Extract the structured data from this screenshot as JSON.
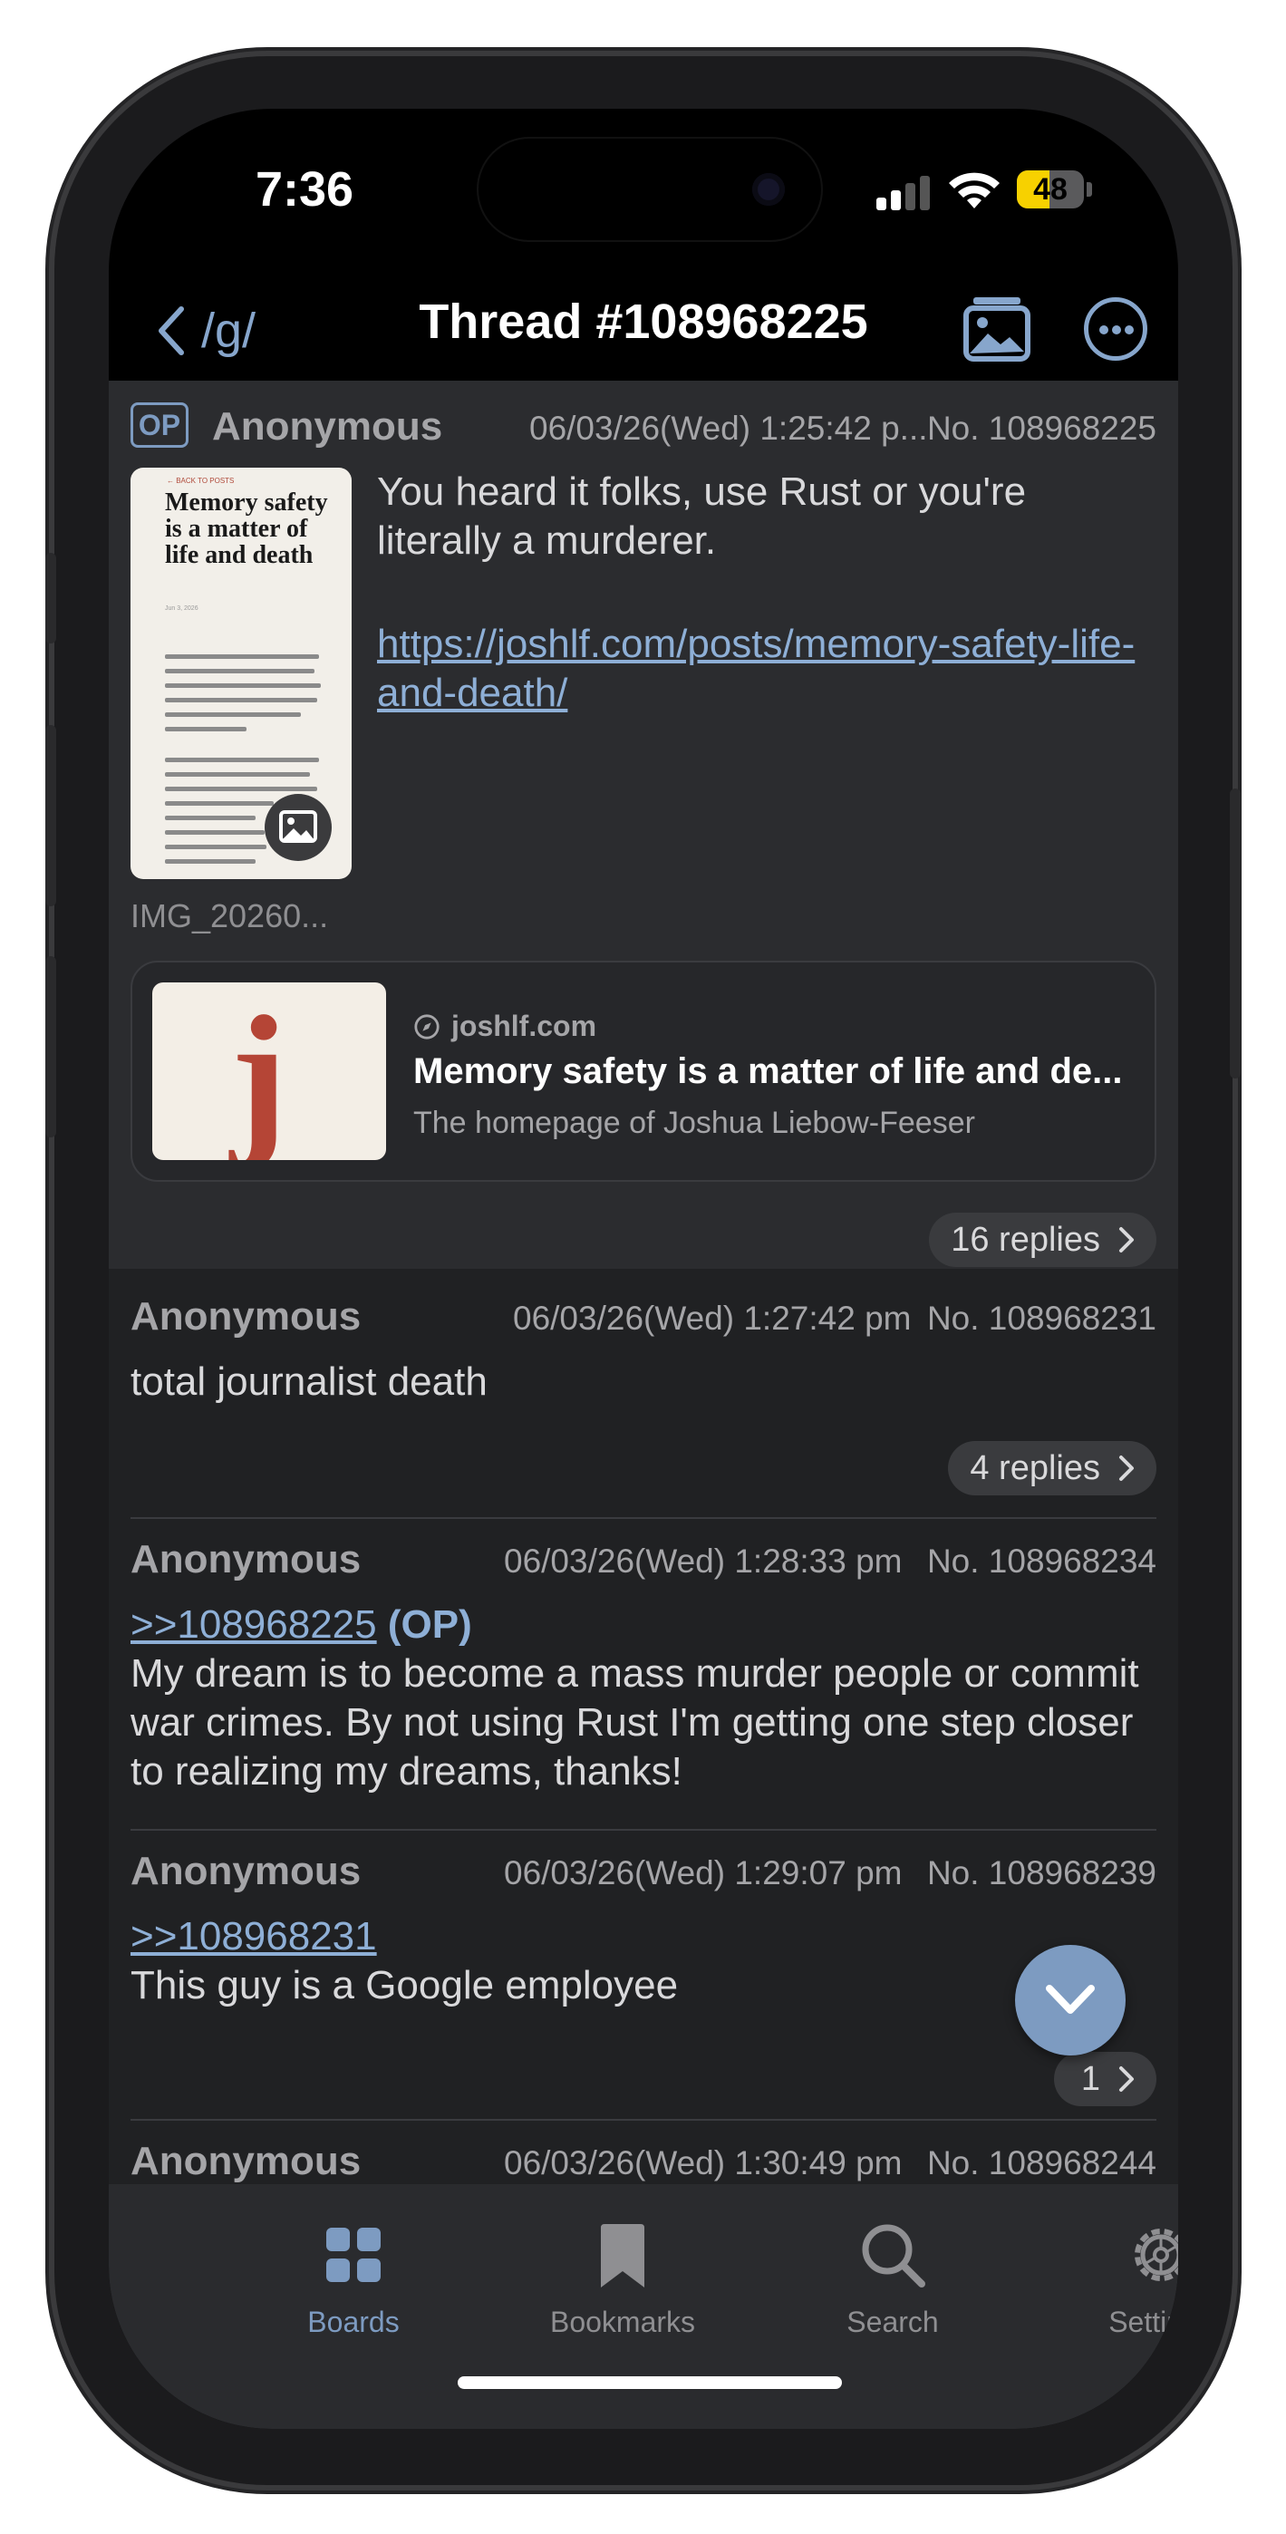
{
  "status_bar": {
    "time": "7:36",
    "battery": "48"
  },
  "nav": {
    "back_label": "/g/",
    "title": "Thread #108968225"
  },
  "op": {
    "badge": "OP",
    "name": "Anonymous",
    "date": "06/03/26(Wed) 1:25:42 p...",
    "number": "No. 108968225",
    "text": "You heard it folks, use Rust or you're literally a murderer.",
    "link": "https://joshlf.com/posts/memory-safety-life-and-death/",
    "thumbnail": {
      "filename": "IMG_20260...",
      "title": "Memory safety is a matter of life and death",
      "kicker": "← BACK TO POSTS",
      "date": "Jun 3, 2026"
    },
    "preview": {
      "domain": "joshlf.com",
      "title": "Memory safety is a matter of life and de...",
      "description": "The homepage of Joshua Liebow-Feeser",
      "image_letter": "j"
    },
    "replies": "16 replies"
  },
  "posts": [
    {
      "name": "Anonymous",
      "date": "06/03/26(Wed) 1:27:42 pm",
      "number": "No. 108968231",
      "text": "total journalist death",
      "replies": "4 replies"
    },
    {
      "name": "Anonymous",
      "date": "06/03/26(Wed) 1:28:33 pm",
      "number": "No. 108968234",
      "quote": ">>108968225",
      "quote_suffix": "(OP)",
      "text": "My dream is to become a mass murder people or commit war crimes. By not using Rust I'm getting one step closer to realizing my dreams, thanks!"
    },
    {
      "name": "Anonymous",
      "date": "06/03/26(Wed) 1:29:07 pm",
      "number": "No. 108968239",
      "quote": ">>108968231",
      "text": "This guy is a Google employee",
      "replies": "1"
    },
    {
      "name": "Anonymous",
      "date": "06/03/26(Wed) 1:30:49 pm",
      "number": "No. 108968244"
    }
  ],
  "tabs": [
    {
      "label": "Boards",
      "icon": "grid-icon",
      "active": true
    },
    {
      "label": "Bookmarks",
      "icon": "bookmark-icon",
      "active": false
    },
    {
      "label": "Search",
      "icon": "search-icon",
      "active": false
    },
    {
      "label": "Settings",
      "icon": "gear-icon",
      "active": false
    }
  ],
  "colors": {
    "accent": "#7d9bc1",
    "link": "#8eafd6",
    "background": "#202123",
    "op_background": "#2b2c2f",
    "battery": "#f7d100"
  }
}
